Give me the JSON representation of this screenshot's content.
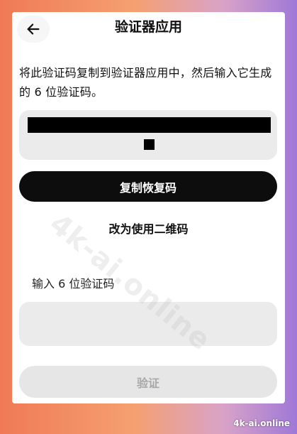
{
  "header": {
    "title": "验证器应用",
    "back_icon": "arrow-left-icon"
  },
  "instruction": "将此验证码复制到验证器应用中，然后输入它生成的 6 位验证码。",
  "recovery_code": {
    "redacted": true
  },
  "copy_button_label": "复制恢复码",
  "qr_link_label": "改为使用二维码",
  "verification": {
    "label": "输入 6 位验证码",
    "value": "",
    "placeholder": ""
  },
  "verify_button_label": "验证",
  "watermarks": {
    "diagonal": "4k-ai.online",
    "corner": "4k-ai.online"
  },
  "colors": {
    "primary_button": "#0d0d0d",
    "disabled_button": "#e6e6e6",
    "input_background": "#ebebeb"
  }
}
